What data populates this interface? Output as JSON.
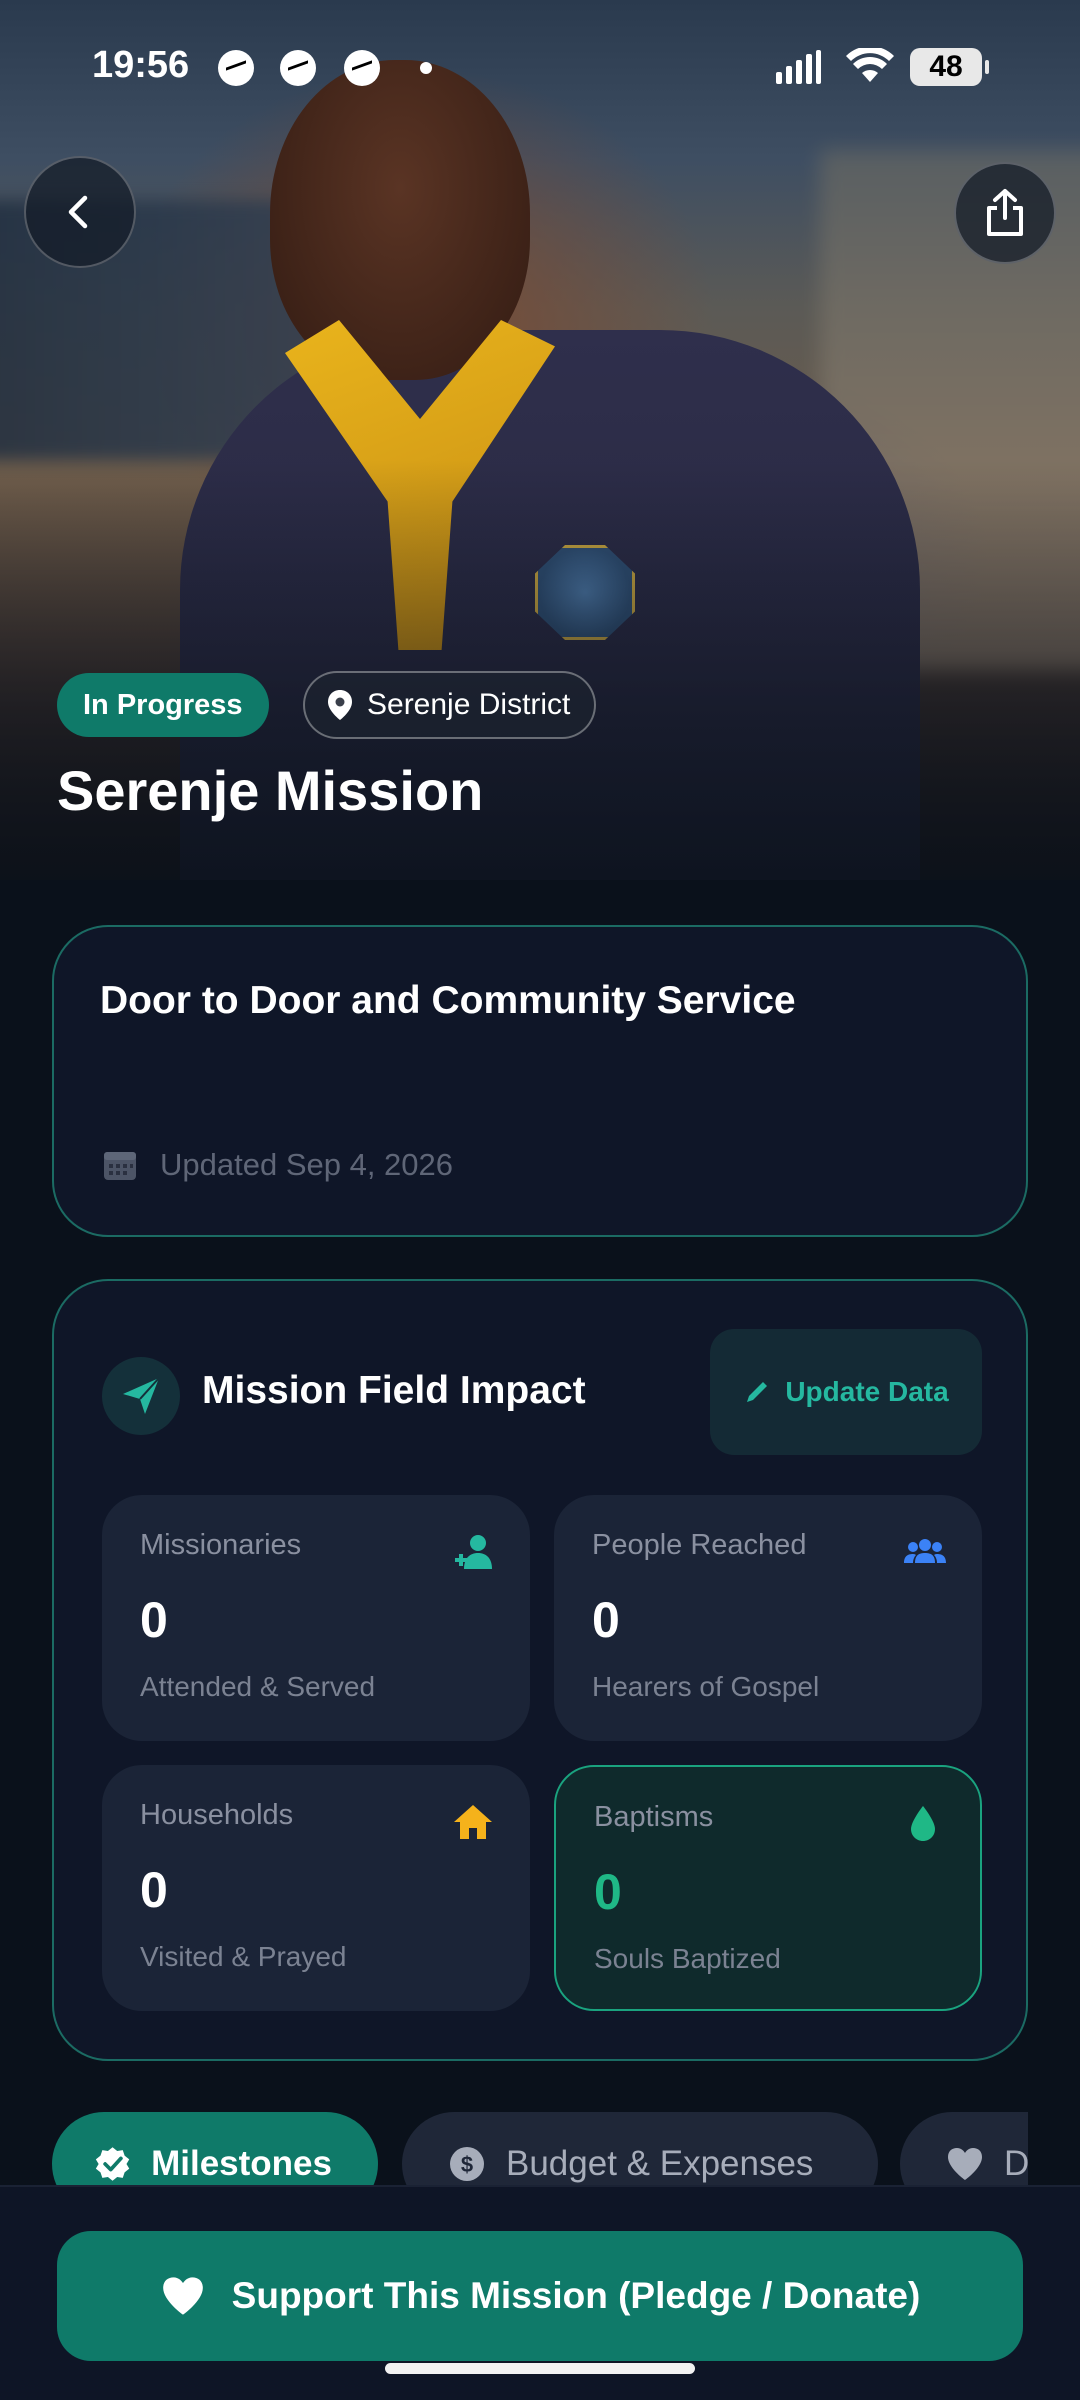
{
  "status_bar": {
    "time": "19:56",
    "battery": "48"
  },
  "hero": {
    "status_chip": "In Progress",
    "location": "Serenje District",
    "title": "Serenje Mission"
  },
  "summary_card": {
    "title": "Door to Door and Community Service",
    "updated": "Updated Sep 4, 2026"
  },
  "impact": {
    "title": "Mission Field Impact",
    "update_button": "Update Data",
    "stats": [
      {
        "label": "Missionaries",
        "value": "0",
        "sub": "Attended & Served",
        "icon": "add-person-icon",
        "color": "#25b8a0"
      },
      {
        "label": "People Reached",
        "value": "0",
        "sub": "Hearers of Gospel",
        "icon": "group-icon",
        "color": "#3b82f6"
      },
      {
        "label": "Households",
        "value": "0",
        "sub": "Visited & Prayed",
        "icon": "home-icon",
        "color": "#f5b21b"
      },
      {
        "label": "Baptisms",
        "value": "0",
        "sub": "Souls Baptized",
        "icon": "water-drop-icon",
        "color": "#1fb886"
      }
    ]
  },
  "tabs": [
    {
      "label": "Milestones",
      "icon": "verified-check-icon",
      "active": true
    },
    {
      "label": "Budget & Expenses",
      "icon": "dollar-icon",
      "active": false
    },
    {
      "label": "D",
      "icon": "heart-icon",
      "active": false
    }
  ],
  "support_button": "Support This Mission (Pledge / Donate)",
  "colors": {
    "accent": "#0f7a69",
    "background": "#0a111b",
    "card": "#0f1628"
  }
}
